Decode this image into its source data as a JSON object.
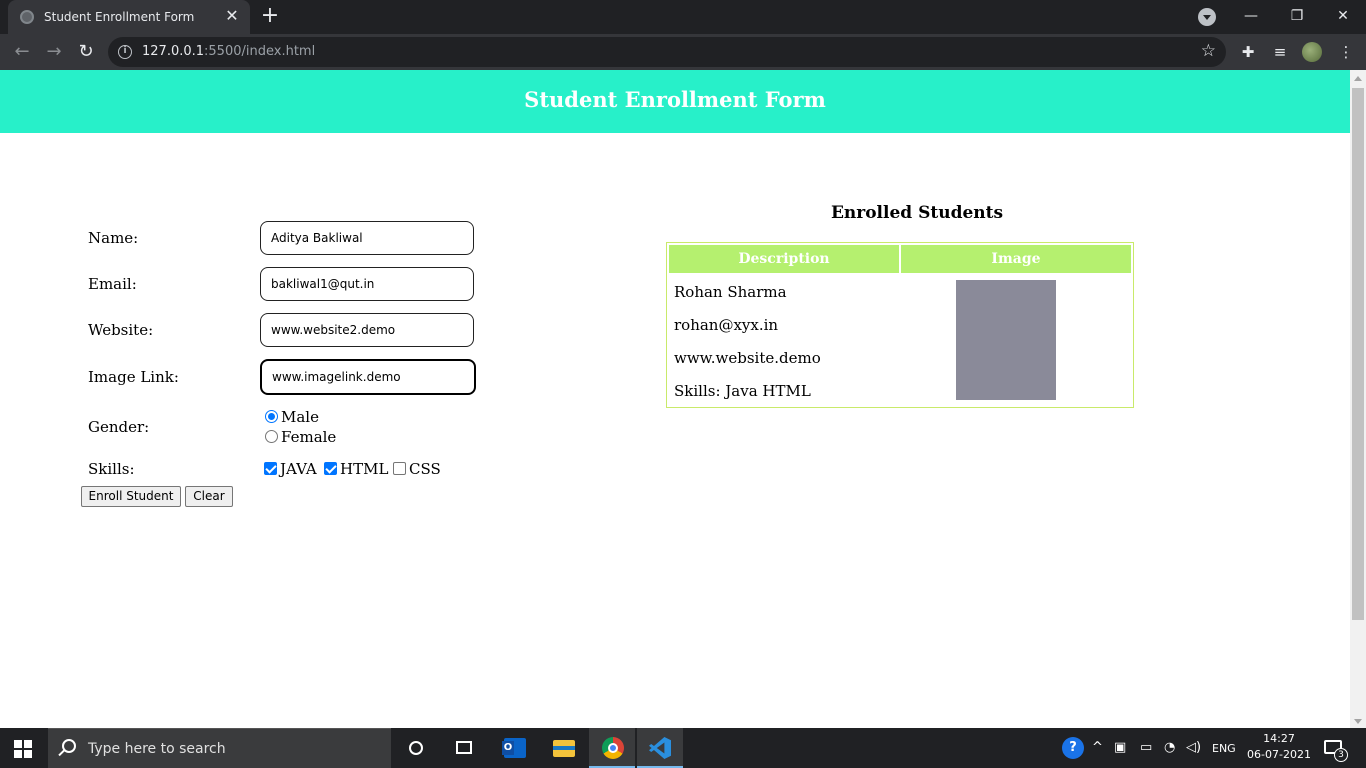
{
  "browser": {
    "tab_title": "Student Enrollment Form",
    "tab_close": "✕",
    "new_tab": "+",
    "url_host": "127.0.0.1",
    "url_rest": ":5500/index.html",
    "window_minimize": "—",
    "window_restore": "❐",
    "window_close": "✕"
  },
  "page": {
    "header": "Student Enrollment Form",
    "form": {
      "name_label": "Name:",
      "name_value": "Aditya Bakliwal",
      "email_label": "Email:",
      "email_value": "bakliwal1@qut.in",
      "website_label": "Website:",
      "website_value": "www.website2.demo",
      "image_label": "Image Link:",
      "image_value": "www.imagelink.demo",
      "gender_label": "Gender:",
      "gender_options": [
        "Male",
        "Female"
      ],
      "gender_selected": "Male",
      "skills_label": "Skills:",
      "skills": [
        {
          "label": "JAVA",
          "checked": true
        },
        {
          "label": "HTML",
          "checked": true
        },
        {
          "label": "CSS",
          "checked": false
        }
      ],
      "enroll_button": "Enroll Student",
      "clear_button": "Clear"
    },
    "enrolled": {
      "title": "Enrolled Students",
      "headers": [
        "Description",
        "Image"
      ],
      "rows": [
        {
          "name": "Rohan Sharma",
          "email": "rohan@xyx.in",
          "website": "www.website.demo",
          "skills": "Skills: Java HTML"
        }
      ]
    },
    "colors": {
      "header_bg": "#27f0c9",
      "table_header_bg": "#b5f06f",
      "table_border": "#c9ea6a",
      "image_placeholder": "#8a8a99"
    }
  },
  "taskbar": {
    "search_placeholder": "Type here to search",
    "language": "ENG",
    "time": "14:27",
    "date": "06-07-2021",
    "notification_count": "3"
  }
}
